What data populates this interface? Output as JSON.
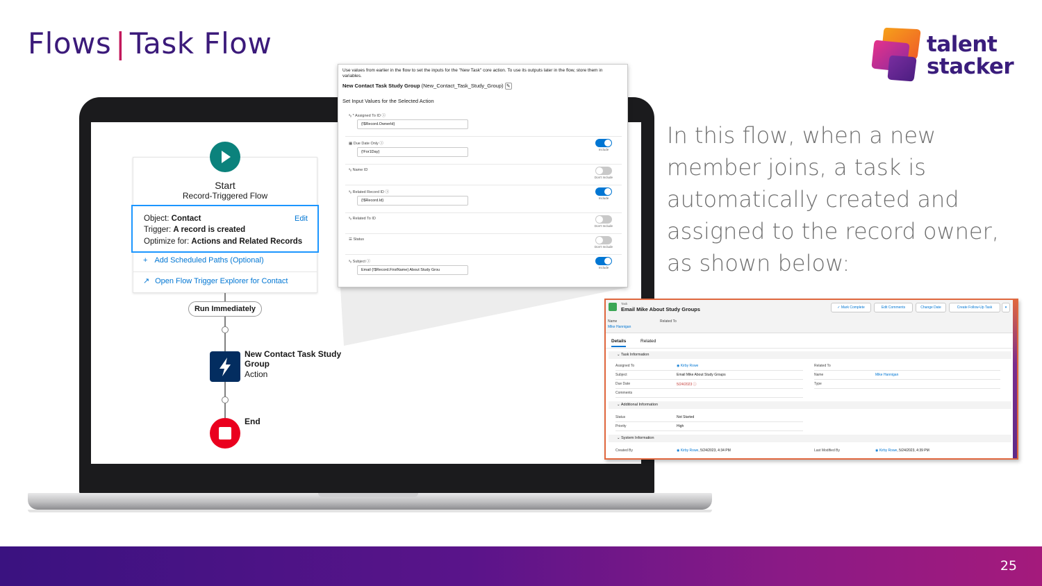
{
  "slide": {
    "title_part1": "Flows",
    "title_sep": "|",
    "title_part2": "Task Flow",
    "description": "In this flow, when a new member joins, a task is automatically created and assigned to the record owner, as shown below:",
    "page_number": "25"
  },
  "logo": {
    "line1": "talent",
    "line2": "stacker"
  },
  "flow": {
    "start_title": "Start",
    "start_subtitle": "Record-Triggered Flow",
    "object_label": "Object:",
    "object_value": "Contact",
    "edit_label": "Edit",
    "trigger_label": "Trigger:",
    "trigger_value": "A record is created",
    "optimize_label": "Optimize for:",
    "optimize_value": "Actions and Related Records",
    "add_paths": "Add Scheduled Paths (Optional)",
    "open_explorer": "Open Flow Trigger Explorer for Contact",
    "run_immediately": "Run Immediately",
    "action_name": "New Contact Task Study Group",
    "action_type": "Action",
    "end_label": "End"
  },
  "panel": {
    "intro": "Use values from earlier in the flow to set the inputs for the \"New Task\" core action. To use its outputs later in the flow, store them in variables.",
    "action_name": "New Contact Task Study Group",
    "action_api": "(New_Contact_Task_Study_Group)",
    "set_inputs": "Set Input Values for the Selected Action",
    "rows": [
      {
        "label": "* Assigned To ID",
        "value": "{!$Record.OwnerId}",
        "toggle": ""
      },
      {
        "label": "Due Date Only",
        "value": "{!For1Day}",
        "toggle": "Include"
      },
      {
        "label": "Name ID",
        "value": "",
        "toggle": "Don't Include"
      },
      {
        "label": "Related Record ID",
        "value": "{!$Record.Id}",
        "toggle": "Include"
      },
      {
        "label": "Related To ID",
        "value": "",
        "toggle": "Don't Include"
      },
      {
        "label": "Status",
        "value": "",
        "toggle": "Don't Include"
      },
      {
        "label": "Subject",
        "value": "Email {!$Record.FirstName} About Study Grou",
        "toggle": "Include"
      }
    ]
  },
  "record": {
    "object_type": "Task",
    "title": "Email Mike About Study Groups",
    "buttons": [
      "Mark Complete",
      "Edit Comments",
      "Change Date",
      "Create Follow-Up Task"
    ],
    "header_fields": {
      "name_label": "Name",
      "name_value": "Mike Hannigan",
      "related_label": "Related To"
    },
    "tabs": [
      "Details",
      "Related"
    ],
    "sections": {
      "task_info": "Task Information",
      "additional": "Additional Information",
      "system": "System Information"
    },
    "fields": {
      "assigned_to_label": "Assigned To",
      "assigned_to_value": "Kirby Rowe",
      "subject_label": "Subject",
      "subject_value": "Email Mike About Study Groups",
      "due_date_label": "Due Date",
      "due_date_value": "5/24/2023",
      "comments_label": "Comments",
      "related_to_label": "Related To",
      "name_label": "Name",
      "name_value": "Mike Hannigan",
      "type_label": "Type",
      "status_label": "Status",
      "status_value": "Not Started",
      "priority_label": "Priority",
      "priority_value": "High",
      "created_by_label": "Created By",
      "created_by_name": "Kirby Rowe",
      "created_by_date": ", 5/24/2023, 4:34 PM",
      "modified_by_label": "Last Modified By",
      "modified_by_name": "Kirby Rowe",
      "modified_by_date": ", 5/24/2023, 4:39 PM"
    }
  },
  "colors": {
    "title": "#3b1a7a",
    "separator": "#c2185b",
    "accent": "#0176d3",
    "record_border": "#e0673e"
  }
}
